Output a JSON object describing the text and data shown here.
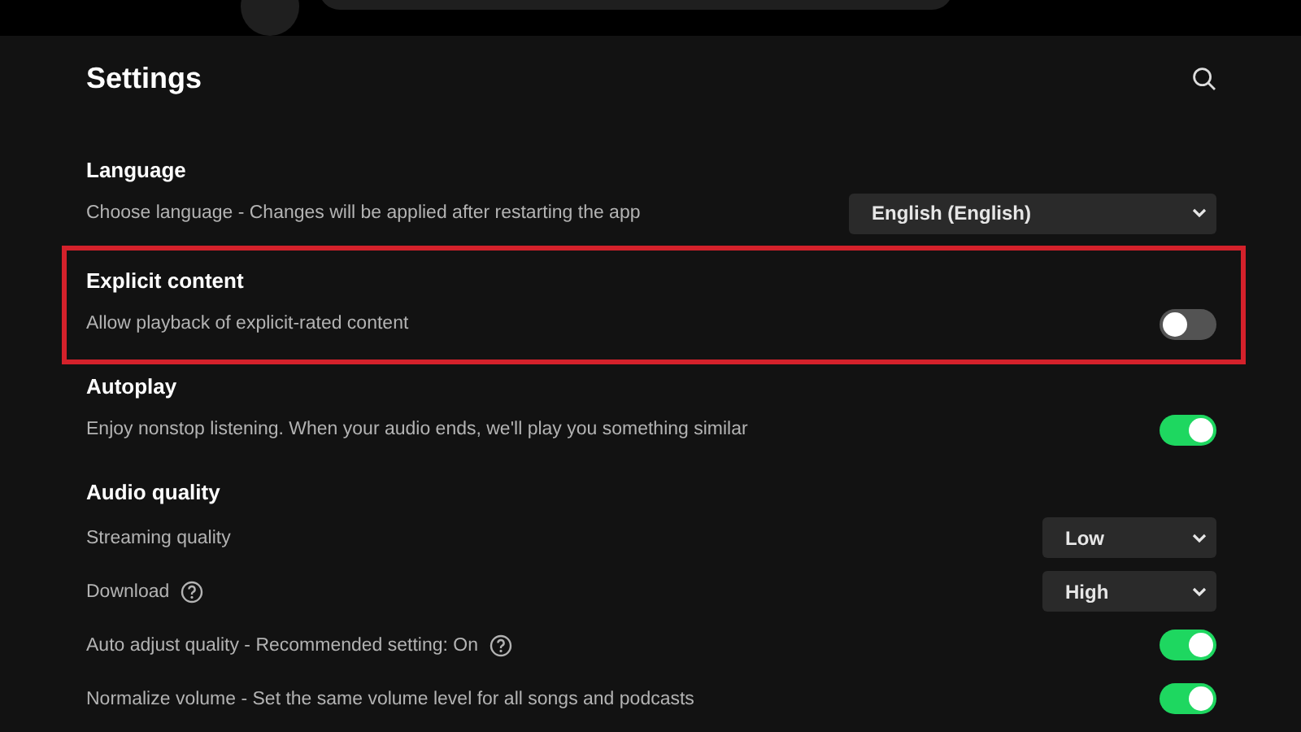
{
  "title": "Settings",
  "sections": [
    {
      "heading": "Language",
      "highlighted": false,
      "rows": [
        {
          "kind": "select",
          "label": "Choose language - Changes will be applied after restarting the app",
          "help": false,
          "value": "English (English)"
        }
      ]
    },
    {
      "heading": "Explicit content",
      "highlighted": true,
      "rows": [
        {
          "kind": "toggle",
          "label": "Allow playback of explicit-rated content",
          "help": false,
          "on": false
        }
      ]
    },
    {
      "heading": "Autoplay",
      "highlighted": false,
      "rows": [
        {
          "kind": "toggle",
          "label": "Enjoy nonstop listening. When your audio ends, we'll play you something similar",
          "help": false,
          "on": true
        }
      ]
    },
    {
      "heading": "Audio quality",
      "highlighted": false,
      "rows": [
        {
          "kind": "select",
          "label": "Streaming quality",
          "help": false,
          "value": "Low"
        },
        {
          "kind": "select",
          "label": "Download",
          "help": true,
          "value": "High"
        },
        {
          "kind": "toggle",
          "label": "Auto adjust quality - Recommended setting: On",
          "help": true,
          "on": true
        },
        {
          "kind": "toggle",
          "label": "Normalize volume - Set the same volume level for all songs and podcasts",
          "help": false,
          "on": true
        }
      ]
    }
  ]
}
